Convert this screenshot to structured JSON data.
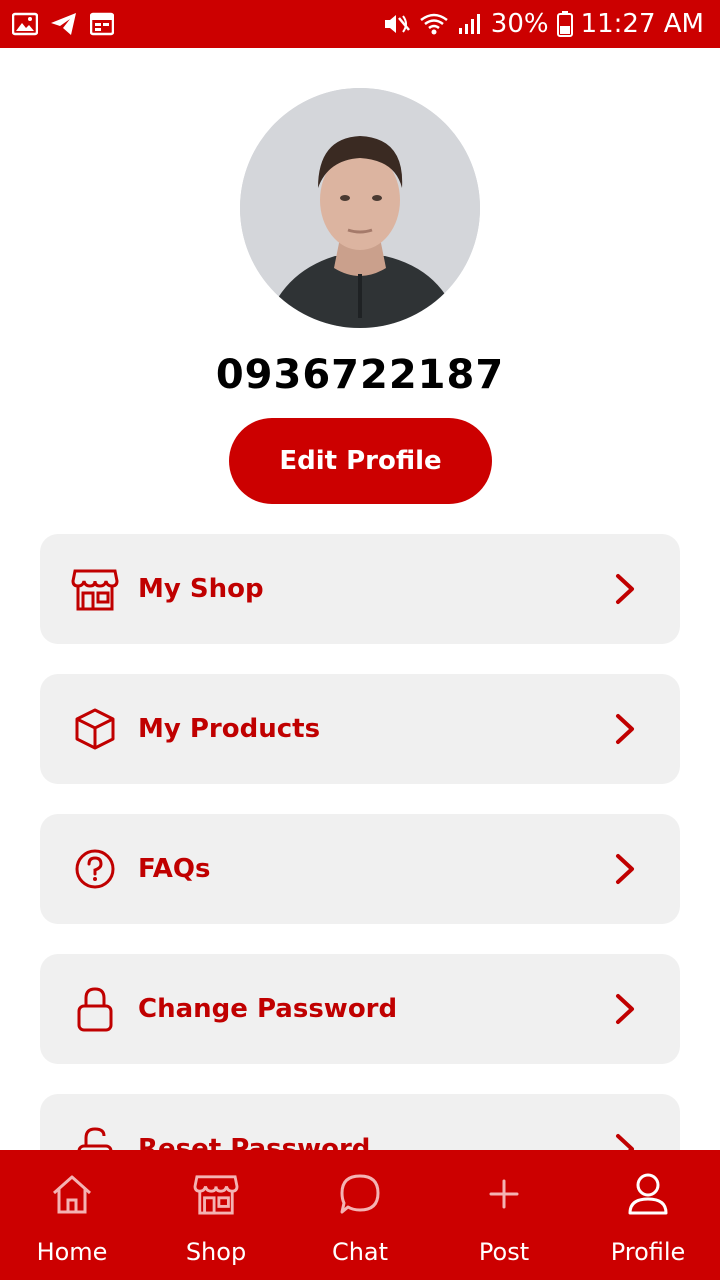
{
  "status_bar": {
    "battery": "30%",
    "time": "11:27 AM",
    "icons_left": [
      "image-icon",
      "telegram-icon",
      "calendar-icon"
    ],
    "icons_right": [
      "mute-icon",
      "wifi-icon",
      "signal-icon",
      "battery-icon"
    ]
  },
  "profile": {
    "phone": "0936722187",
    "edit_label": "Edit Profile"
  },
  "menu": {
    "items": [
      {
        "label": "My Shop",
        "icon": "shop-icon"
      },
      {
        "label": "My Products",
        "icon": "box-icon"
      },
      {
        "label": "FAQs",
        "icon": "question-icon"
      },
      {
        "label": "Change Password",
        "icon": "lock-icon"
      },
      {
        "label": "Reset Password",
        "icon": "unlock-icon"
      }
    ]
  },
  "nav": {
    "items": [
      {
        "label": "Home",
        "icon": "home-icon",
        "active": false
      },
      {
        "label": "Shop",
        "icon": "shop-icon",
        "active": false
      },
      {
        "label": "Chat",
        "icon": "chat-icon",
        "active": false
      },
      {
        "label": "Post",
        "icon": "plus-icon",
        "active": false
      },
      {
        "label": "Profile",
        "icon": "user-icon",
        "active": true
      }
    ]
  },
  "colors": {
    "primary": "#cc0000",
    "menu_bg": "#f0f0f0",
    "nav_inactive": "#f4b3b3",
    "nav_active": "#ffffff"
  }
}
